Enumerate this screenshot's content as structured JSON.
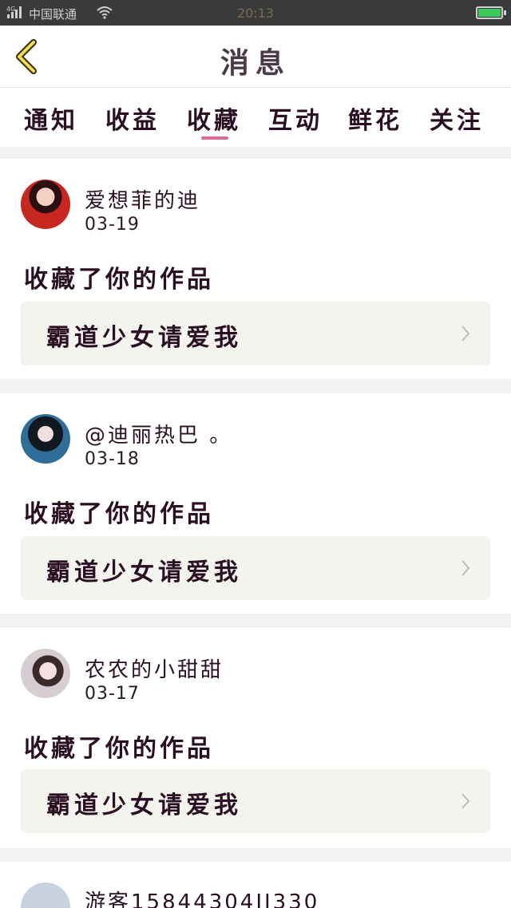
{
  "status_bar": {
    "signal_icon": "signal-4g-icon",
    "network_label": "4G",
    "carrier": "中国联通",
    "wifi_icon": "wifi-icon",
    "time": "20:13",
    "battery_icon": "battery-charging-icon",
    "battery_color": "#38c95a"
  },
  "header": {
    "back_icon": "chevron-left-icon",
    "title": "消息"
  },
  "tabs": [
    {
      "label": "通知"
    },
    {
      "label": "收益"
    },
    {
      "label": "收藏",
      "active": true
    },
    {
      "label": "互动"
    },
    {
      "label": "鲜花"
    },
    {
      "label": "关注"
    }
  ],
  "accent_color": "#e26a90",
  "notifications": [
    {
      "username": "爱想菲的迪",
      "date": "03-19",
      "action": "收藏了你的作品",
      "work_title": "霸道少女请爱我"
    },
    {
      "username": "@迪丽热巴 。",
      "date": "03-18",
      "action": "收藏了你的作品",
      "work_title": "霸道少女请爱我"
    },
    {
      "username": "农农的小甜甜",
      "date": "03-17",
      "action": "收藏了你的作品",
      "work_title": "霸道少女请爱我"
    },
    {
      "username": "游客15844304II330",
      "date": "",
      "action": "",
      "work_title": ""
    }
  ]
}
